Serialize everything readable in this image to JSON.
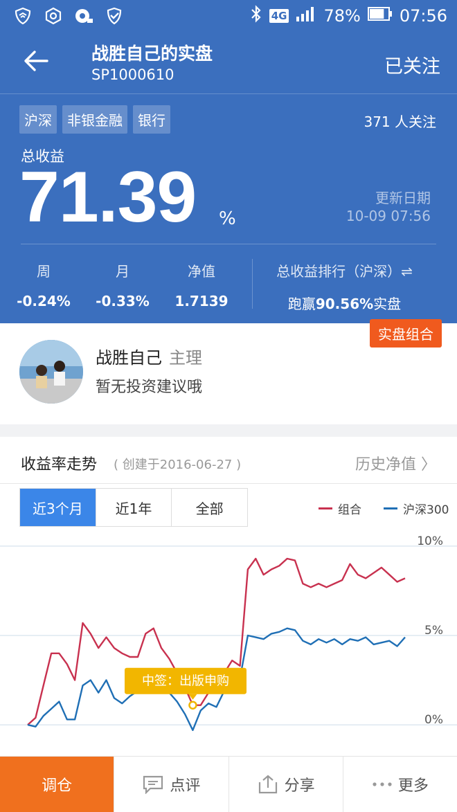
{
  "status_bar": {
    "battery_pct": "78%",
    "time": "07:56",
    "network_badge": "4G",
    "battery_level": 0.78,
    "icons": [
      "shield-icon",
      "hex-gear-icon",
      "monitor-icon",
      "shield-check-icon",
      "bluetooth-icon",
      "signal-icon",
      "battery-icon"
    ]
  },
  "header": {
    "title": "战胜自己的实盘",
    "subtitle": "SP1000610",
    "follow_label": "已关注"
  },
  "summary": {
    "tags": [
      "沪深",
      "非银金融",
      "银行"
    ],
    "followers": "371 人关注",
    "total_label": "总收益",
    "total_value": "71.39",
    "total_unit": "%",
    "update_label": "更新日期",
    "update_value": "10-09 07:56",
    "stats": [
      {
        "label": "周",
        "value": "-0.24%"
      },
      {
        "label": "月",
        "value": "-0.33%"
      },
      {
        "label": "净值",
        "value": "1.7139"
      }
    ],
    "rank_label": "总收益排行（沪深）⇌",
    "rank_prefix": "跑赢",
    "rank_value": "90.56%",
    "rank_suffix": "实盘"
  },
  "manager": {
    "badge": "实盘组合",
    "name": "战胜自己",
    "role": "主理",
    "advice": "暂无投资建议哦"
  },
  "trend": {
    "title": "收益率走势",
    "created": "( 创建于2016-06-27 )",
    "history_link": "历史净值 〉",
    "period_tabs": [
      "近3个月",
      "近1年",
      "全部"
    ],
    "active_tab": 0,
    "legend": [
      {
        "name": "组合",
        "color": "#c8314f"
      },
      {
        "name": "沪深300",
        "color": "#1f6fb5"
      }
    ],
    "annotation": "中签：出版申购"
  },
  "chart_data": {
    "type": "line",
    "y_ticks": [
      "10%",
      "5%",
      "0%"
    ],
    "ylim": [
      -0.5,
      10.5
    ],
    "x": [
      0,
      1,
      2,
      3,
      4,
      5,
      6,
      7,
      8,
      9,
      10,
      11,
      12,
      13,
      14,
      15,
      16,
      17,
      18,
      19,
      20,
      21,
      22,
      23,
      24,
      25,
      26,
      27,
      28,
      29,
      30,
      31,
      32,
      33,
      34,
      35,
      36,
      37,
      38,
      39,
      40,
      41,
      42,
      43,
      44,
      45,
      46,
      47,
      48
    ],
    "series": [
      {
        "name": "组合",
        "color": "#c8314f",
        "values": [
          0,
          0.4,
          2.2,
          4,
          4,
          3.4,
          2.5,
          5.7,
          5.1,
          4.3,
          4.9,
          4.3,
          4,
          3.8,
          3.8,
          5.1,
          5.4,
          4.3,
          3.7,
          2.9,
          2.1,
          1.1,
          1.1,
          1.8,
          2.2,
          2.9,
          3.6,
          3.3,
          8.7,
          9.3,
          8.4,
          8.7,
          8.9,
          9.3,
          9.2,
          7.9,
          7.7,
          7.9,
          7.7,
          7.9,
          8.1,
          9.0,
          8.4,
          8.2,
          8.5,
          8.8,
          8.4,
          8.0,
          8.2
        ]
      },
      {
        "name": "沪深300",
        "color": "#1f6fb5",
        "values": [
          0,
          -0.1,
          0.5,
          0.9,
          1.3,
          0.3,
          0.3,
          2.2,
          2.5,
          1.8,
          2.5,
          1.5,
          1.2,
          1.6,
          1.9,
          3.0,
          2.5,
          2.1,
          1.8,
          1.3,
          0.6,
          -0.3,
          0.8,
          1.2,
          1.0,
          1.9,
          2.5,
          2.6,
          5.0,
          4.9,
          4.8,
          5.1,
          5.2,
          5.4,
          5.3,
          4.7,
          4.5,
          4.8,
          4.6,
          4.8,
          4.5,
          4.8,
          4.7,
          4.9,
          4.5,
          4.6,
          4.7,
          4.4,
          4.9
        ]
      }
    ],
    "annotation": {
      "label": "中签：出版申购",
      "x": 21
    }
  },
  "bottom_bar": {
    "buttons": [
      {
        "label": "调仓",
        "icon": ""
      },
      {
        "label": "点评",
        "icon": "comment-icon"
      },
      {
        "label": "分享",
        "icon": "share-icon"
      },
      {
        "label": "更多",
        "icon": "more-icon"
      }
    ]
  }
}
